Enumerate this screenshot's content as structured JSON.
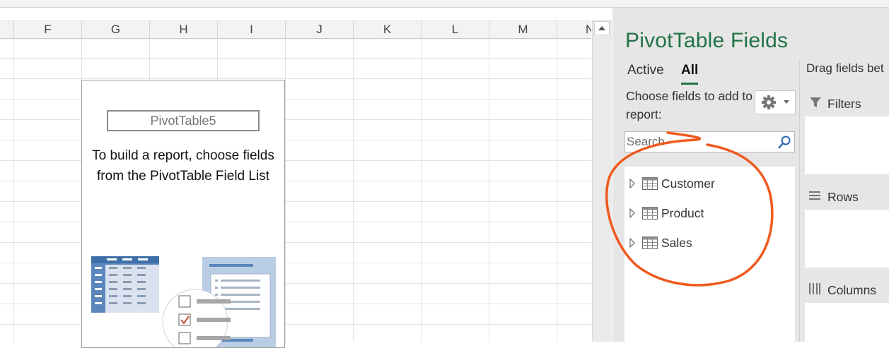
{
  "sheet": {
    "columns": [
      "F",
      "G",
      "H",
      "I",
      "J",
      "K",
      "L",
      "M",
      "N"
    ]
  },
  "pivot_placeholder": {
    "name": "PivotTable5",
    "message": "To build a report, choose fields from the PivotTable Field List"
  },
  "pane": {
    "title": "PivotTable Fields",
    "tabs": [
      {
        "label": "Active",
        "active": false
      },
      {
        "label": "All",
        "active": true
      }
    ],
    "choose_text": "Choose fields to add to report:",
    "tools_icon": "gear-icon",
    "search": {
      "placeholder": "Search",
      "value": ""
    },
    "fields": [
      {
        "label": "Customer"
      },
      {
        "label": "Product"
      },
      {
        "label": "Sales"
      }
    ],
    "drag_text": "Drag fields bet",
    "areas": [
      {
        "label": "Filters",
        "icon": "filter-icon"
      },
      {
        "label": "Rows",
        "icon": "rows-icon"
      },
      {
        "label": "Columns",
        "icon": "columns-icon"
      }
    ]
  },
  "colors": {
    "accent": "#217346",
    "annotation": "#f05a1e"
  }
}
